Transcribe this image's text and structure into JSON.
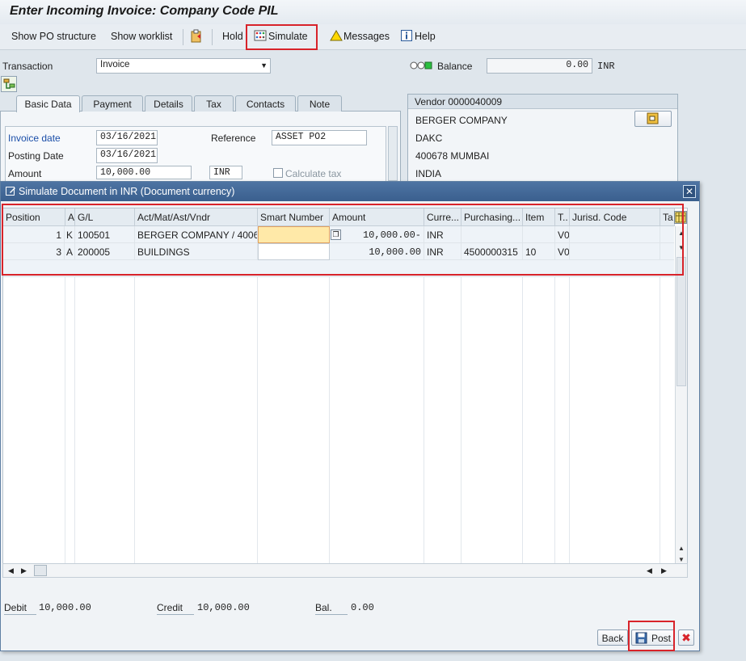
{
  "window": {
    "title": "Enter Incoming Invoice: Company Code PIL"
  },
  "toolbar": {
    "show_po_structure": "Show PO structure",
    "show_worklist": "Show worklist",
    "hold": "Hold",
    "simulate": "Simulate",
    "messages": "Messages",
    "help": "Help"
  },
  "header": {
    "transaction_label": "Transaction",
    "transaction_value": "Invoice",
    "balance_label": "Balance",
    "balance_value": "0.00",
    "balance_currency": "INR"
  },
  "tabs": [
    "Basic Data",
    "Payment",
    "Details",
    "Tax",
    "Contacts",
    "Note"
  ],
  "basic_data": {
    "invoice_date_label": "Invoice date",
    "invoice_date": "03/16/2021",
    "reference_label": "Reference",
    "reference": "ASSET PO2",
    "posting_date_label": "Posting Date",
    "posting_date": "03/16/2021",
    "amount_label": "Amount",
    "amount": "10,000.00",
    "currency": "INR",
    "calculate_tax": "Calculate tax"
  },
  "vendor": {
    "title": "Vendor 0000040009",
    "name": "BERGER COMPANY",
    "line2": "DAKC",
    "line3": "400678 MUMBAI",
    "country": "INDIA"
  },
  "dialog": {
    "title": "Simulate Document in INR (Document currency)",
    "columns": [
      "Position",
      "A",
      "G/L",
      "Act/Mat/Ast/Vndr",
      "Smart Number",
      "Amount",
      "Curre...",
      "Purchasing...",
      "Item",
      "T..",
      "Jurisd. Code",
      "Ta"
    ],
    "rows": [
      {
        "position": "1",
        "a": "K",
        "gl": "100501",
        "act": "BERGER COMPANY / 4006...",
        "smart": "",
        "amount": "10,000.00-",
        "curr": "INR",
        "purch": "",
        "item": "",
        "t": "V0",
        "jur": ""
      },
      {
        "position": "3",
        "a": "A",
        "gl": "200005",
        "act": "BUILDINGS",
        "smart": "",
        "amount": "10,000.00",
        "curr": "INR",
        "purch": "4500000315",
        "item": "10",
        "t": "V0",
        "jur": ""
      }
    ],
    "debit_label": "Debit",
    "debit": "10,000.00",
    "credit_label": "Credit",
    "credit": "10,000.00",
    "bal_label": "Bal.",
    "bal": "0.00",
    "back": "Back",
    "post": "Post"
  },
  "colors": {
    "accent_red": "#d8232a",
    "dialog_title": "#3a5f8e"
  }
}
